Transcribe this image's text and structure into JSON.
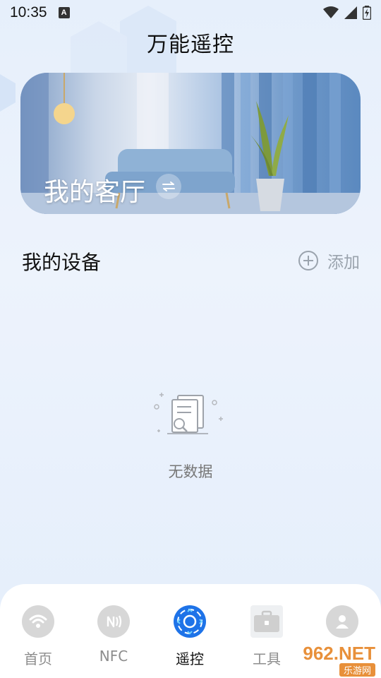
{
  "status_bar": {
    "time": "10:35",
    "notification_icon": "A",
    "icons": [
      "wifi-icon",
      "signal-icon",
      "battery-charging-icon"
    ]
  },
  "header": {
    "title": "万能遥控"
  },
  "room_card": {
    "name": "我的客厅",
    "switch_icon": "swap-icon"
  },
  "devices": {
    "section_title": "我的设备",
    "add_label": "添加",
    "add_icon": "plus-circle-icon",
    "empty_text": "无数据",
    "empty_icon": "document-search-icon"
  },
  "tabbar": {
    "tabs": [
      {
        "label": "首页",
        "icon": "wifi-icon",
        "active": false
      },
      {
        "label": "NFC",
        "icon": "nfc-icon",
        "active": false
      },
      {
        "label": "遥控",
        "icon": "remote-control-icon",
        "active": true
      },
      {
        "label": "工具",
        "icon": "toolbox-icon",
        "active": false
      },
      {
        "label": "",
        "icon": "user-icon",
        "active": false
      }
    ]
  },
  "watermark": {
    "main": "962.NET",
    "sub": "乐游网"
  },
  "colors": {
    "accent": "#1e73e8",
    "inactive_icon": "#d7d7d7",
    "inactive_label": "#8d8d8d",
    "watermark": "#e8903a"
  }
}
